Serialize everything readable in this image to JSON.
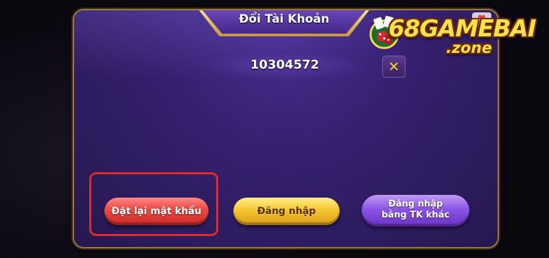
{
  "dialog": {
    "title": "Đổi Tài Khoản",
    "account_id": "10304572",
    "close_label": "✕"
  },
  "buttons": {
    "reset_password": "Đặt lại mật khẩu",
    "login": "Đăng nhập",
    "login_other_line1": "Đăng nhập",
    "login_other_line2": "bằng TK khác"
  },
  "logo": {
    "main": "68GAMEBAI",
    "sub": ".zone"
  },
  "colors": {
    "highlight": "#e12a2a",
    "modal_bg": "#34206e",
    "red_button": "#ef4b45",
    "gold_button": "#f5c531",
    "purple_button": "#8c55e6"
  }
}
